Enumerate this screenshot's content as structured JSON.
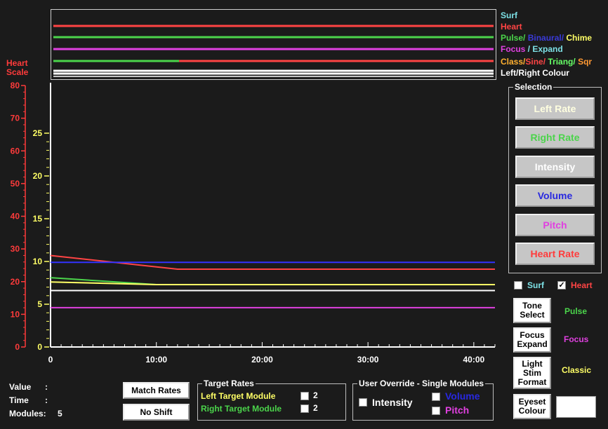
{
  "legend": {
    "items": [
      {
        "parts": [
          {
            "text": "Surf",
            "color": "#7de1e6"
          }
        ]
      },
      {
        "parts": [
          {
            "text": "Heart",
            "color": "#ff4444"
          }
        ]
      },
      {
        "parts": [
          {
            "text": "Pulse/ ",
            "color": "#4bd44b"
          },
          {
            "text": "Binaural/ ",
            "color": "#3a3ad8"
          },
          {
            "text": "Chime",
            "color": "#ffff66"
          }
        ]
      },
      {
        "parts": [
          {
            "text": "Focus ",
            "color": "#e040e0"
          },
          {
            "text": "/ Expand",
            "color": "#7de1e6"
          }
        ]
      },
      {
        "parts": [
          {
            "text": "Class/",
            "color": "#ffb030"
          },
          {
            "text": "Sine/ ",
            "color": "#ff4444"
          },
          {
            "text": "Triang/ ",
            "color": "#66ff66"
          },
          {
            "text": "Sqr",
            "color": "#ff9933"
          }
        ]
      },
      {
        "parts": [
          {
            "text": "Left/Right Colour",
            "color": "#ffffff"
          }
        ]
      }
    ]
  },
  "heart_scale": {
    "line1": "Heart",
    "line2": "Scale",
    "ticks": [
      "80",
      "70",
      "60",
      "50",
      "40",
      "30",
      "20",
      "10",
      "0"
    ]
  },
  "left_axis": {
    "ticks": [
      "25",
      "20",
      "15",
      "10",
      "5",
      "0"
    ]
  },
  "x_axis": {
    "ticks": [
      "0",
      "10:00",
      "20:00",
      "30:00",
      "40:00"
    ]
  },
  "chart_data": {
    "type": "line",
    "x_unit": "minutes",
    "xlim": [
      0,
      42
    ],
    "ylim": [
      0,
      28
    ],
    "heart_ylim": [
      0,
      80
    ],
    "series": [
      {
        "color": "#ff4444",
        "points": [
          [
            0,
            10.7
          ],
          [
            12,
            9.1
          ],
          [
            42,
            9.1
          ]
        ]
      },
      {
        "color": "#3333ff",
        "points": [
          [
            0,
            9.9
          ],
          [
            42,
            9.9
          ]
        ]
      },
      {
        "color": "#4bd44b",
        "points": [
          [
            0,
            8.1
          ],
          [
            10,
            7.3
          ],
          [
            42,
            7.3
          ]
        ]
      },
      {
        "color": "#ffff66",
        "points": [
          [
            0,
            7.6
          ],
          [
            10,
            7.3
          ],
          [
            42,
            7.3
          ]
        ]
      },
      {
        "color": "#ffffff",
        "points": [
          [
            0,
            6.6
          ],
          [
            42,
            6.6
          ]
        ]
      },
      {
        "color": "#e040e0",
        "points": [
          [
            0,
            4.6
          ],
          [
            42,
            4.6
          ]
        ]
      }
    ],
    "top_strips": [
      {
        "color": "#ff4444",
        "segments": [
          [
            0,
            42
          ]
        ]
      },
      {
        "color": "#4bd44b",
        "segments": [
          [
            0,
            42
          ]
        ]
      },
      {
        "color": "#e040e0",
        "segments": [
          [
            0,
            42
          ]
        ]
      },
      {
        "color": "#4bd44b",
        "segments": [
          [
            0,
            12
          ]
        ]
      },
      {
        "color": "#ff4444",
        "segments": [
          [
            12,
            42
          ]
        ]
      },
      {
        "color": "#ffffff",
        "segments": [
          [
            0,
            42
          ]
        ]
      },
      {
        "color": "#ffffff",
        "segments": [
          [
            0,
            42
          ]
        ]
      }
    ]
  },
  "selection": {
    "title": "Selection",
    "buttons": [
      {
        "label": "Left Rate",
        "color": "#ffffe0"
      },
      {
        "label": "Right Rate",
        "color": "#4bd44b"
      },
      {
        "label": "Intensity",
        "color": "#ffffff"
      },
      {
        "label": "Volume",
        "color": "#2828e0"
      },
      {
        "label": "Pitch",
        "color": "#e040e0"
      },
      {
        "label": "Heart Rate",
        "color": "#ff3b3b"
      }
    ]
  },
  "toggles": {
    "surf": "Surf",
    "surf_checked": "",
    "heart": "Heart",
    "heart_checked": "✓"
  },
  "tools": {
    "tone_select": "Tone Select",
    "tone_value": "Pulse",
    "focus_expand": "Focus Expand",
    "focus_value": "Focus",
    "light_stim": "Light Stim Format",
    "light_value": "Classic",
    "eyeset": "Eyeset Colour"
  },
  "info": {
    "value_label": "Value",
    "value_colon": ":",
    "time_label": "Time",
    "time_colon": ":",
    "modules_label": "Modules:",
    "modules_value": "5"
  },
  "actions": {
    "match_rates": "Match Rates",
    "no_shift": "No Shift"
  },
  "target_rates": {
    "title": "Target Rates",
    "left": "Left Target Module",
    "right": "Right Target Module",
    "left_num": "2",
    "right_num": "2"
  },
  "override": {
    "title": "User Override - Single Modules",
    "intensity": "Intensity",
    "volume": "Volume",
    "pitch": "Pitch"
  }
}
